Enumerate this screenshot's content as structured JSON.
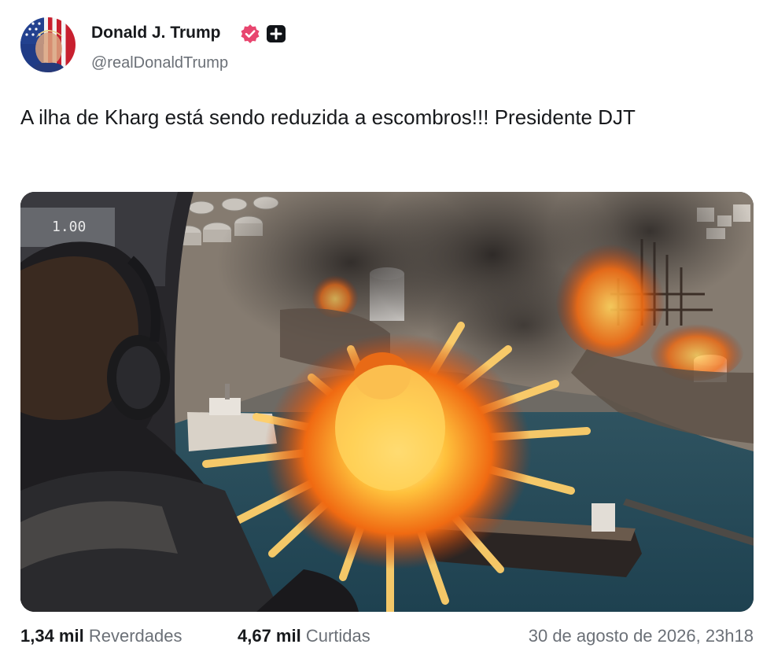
{
  "author": {
    "display_name": "Donald J. Trump",
    "handle": "@realDonaldTrump",
    "avatar_icon": "avatar-flag-portrait",
    "verified_icon": "verified-badge-icon",
    "verified_color": "#e8466f",
    "plus_icon": "plus-square-icon"
  },
  "post": {
    "text": "A ilha de Kharg está sendo reduzida a escombros!!! Presidente DJT",
    "media": {
      "overlay_text": "1.00"
    }
  },
  "stats": {
    "reposts_count": "1,34 mil",
    "reposts_label": "Reverdades",
    "likes_count": "4,67 mil",
    "likes_label": "Curtidas",
    "timestamp": "30 de agosto de 2026, 23h18"
  }
}
